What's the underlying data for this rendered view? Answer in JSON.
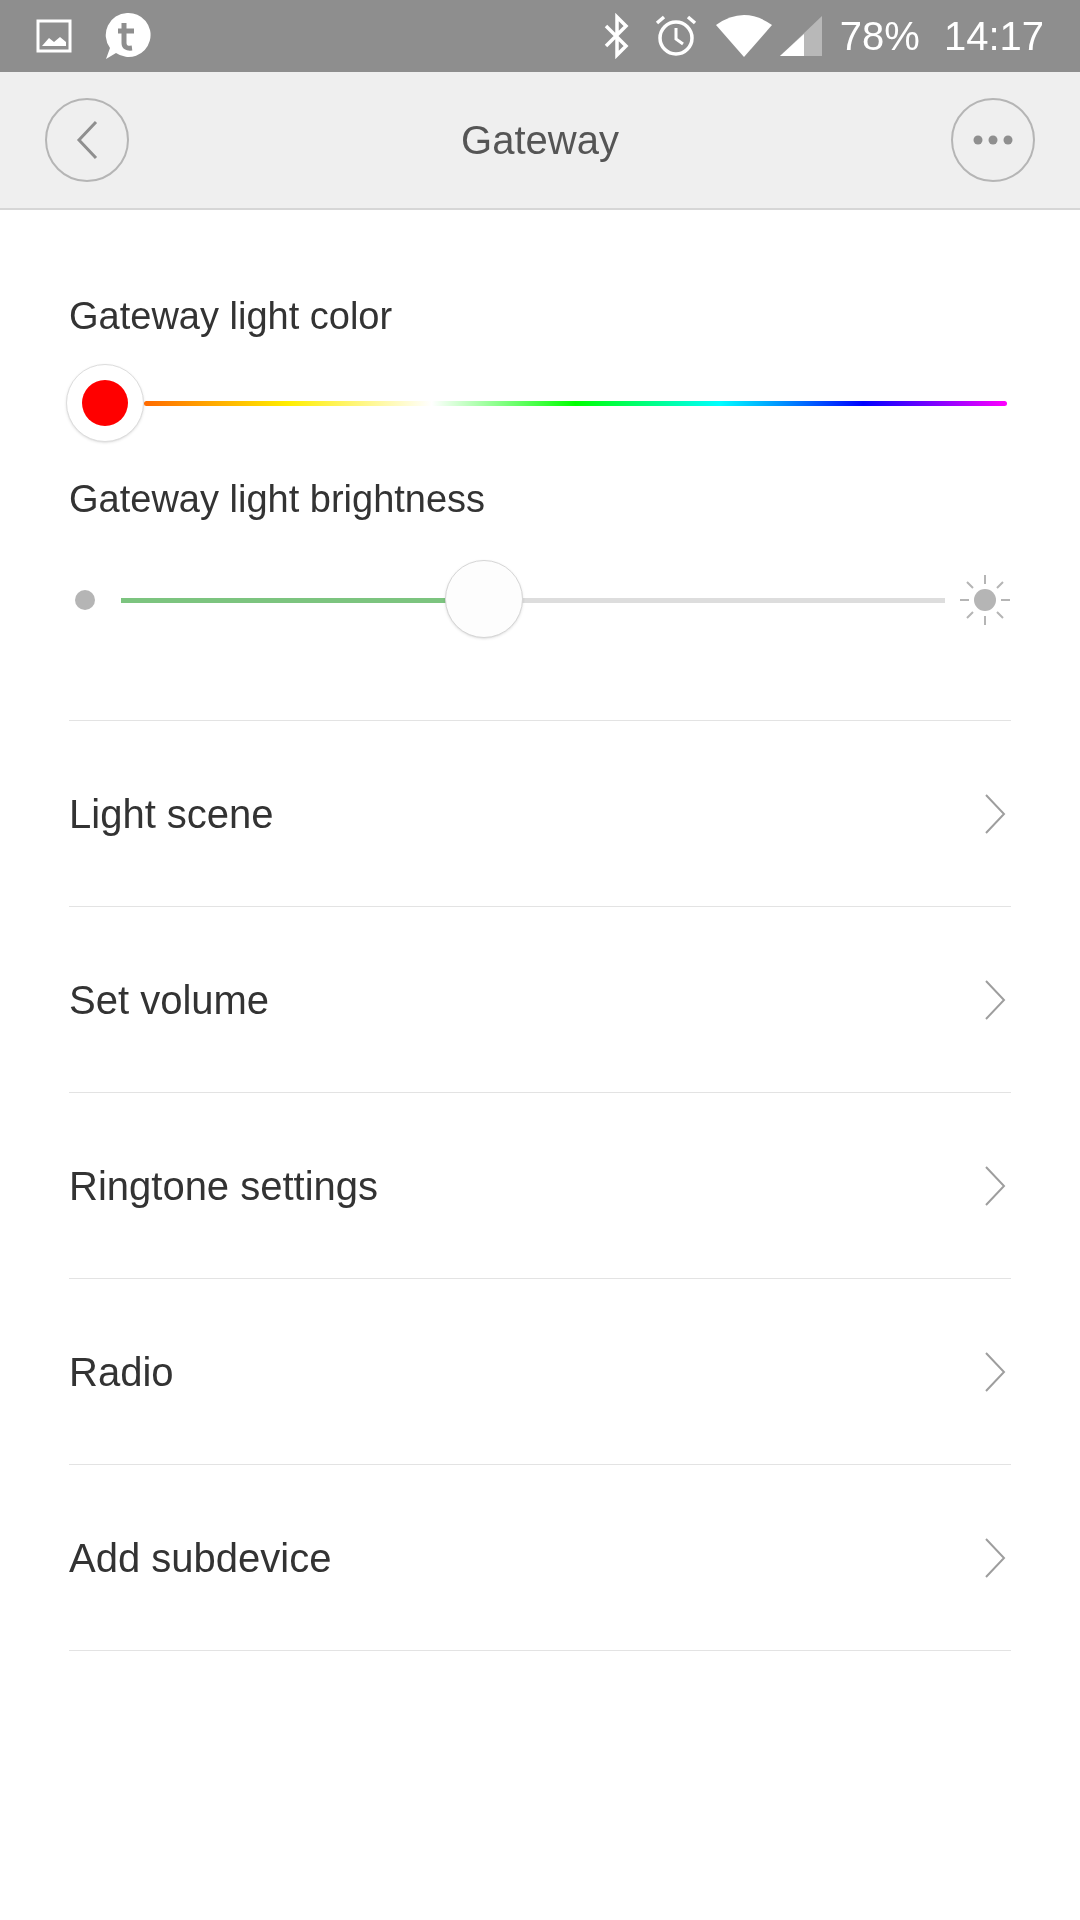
{
  "status_bar": {
    "battery": "78%",
    "time": "14:17"
  },
  "header": {
    "title": "Gateway"
  },
  "color_slider": {
    "label": "Gateway light color",
    "color": "#ff0000"
  },
  "brightness_slider": {
    "label": "Gateway light brightness",
    "level": 0.44
  },
  "menu": [
    {
      "label": "Light scene"
    },
    {
      "label": "Set volume"
    },
    {
      "label": "Ringtone settings"
    },
    {
      "label": "Radio"
    },
    {
      "label": "Add subdevice"
    }
  ]
}
